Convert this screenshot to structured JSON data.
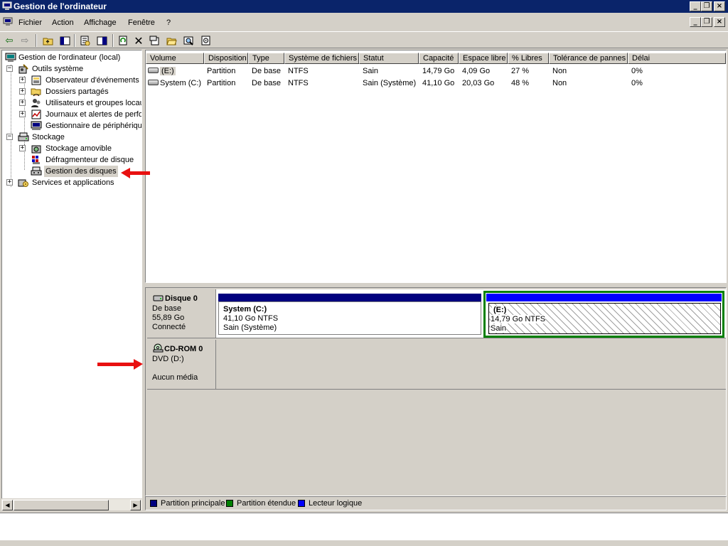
{
  "window": {
    "title": "Gestion de l'ordinateur"
  },
  "menu": {
    "items": [
      "Fichier",
      "Action",
      "Affichage",
      "Fenêtre",
      "?"
    ]
  },
  "toolbar": {
    "icons": [
      "back-arrow-icon",
      "forward-arrow-icon",
      "up-folder-icon",
      "show-hide-tree-icon",
      "properties-icon",
      "help-icon",
      "refresh-icon",
      "delete-icon",
      "properties-sheet-icon",
      "open-folder-icon",
      "search-icon",
      "settings-icon"
    ]
  },
  "tree": {
    "root": "Gestion de l'ordinateur (local)",
    "items": [
      {
        "label": "Outils système"
      },
      {
        "label": "Observateur d'événements"
      },
      {
        "label": "Dossiers partagés"
      },
      {
        "label": "Utilisateurs et groupes locaux"
      },
      {
        "label": "Journaux et alertes de performance"
      },
      {
        "label": "Gestionnaire de périphériques"
      },
      {
        "label": "Stockage"
      },
      {
        "label": "Stockage amovible"
      },
      {
        "label": "Défragmenteur de disque"
      },
      {
        "label": "Gestion des disques",
        "selected": true
      },
      {
        "label": "Services et applications"
      }
    ]
  },
  "volume_table": {
    "columns": [
      "Volume",
      "Disposition",
      "Type",
      "Système de fichiers",
      "Statut",
      "Capacité",
      "Espace libre",
      "% Libres",
      "Tolérance de pannes",
      "Délai"
    ],
    "rows": [
      {
        "volume": "(E:)",
        "disposition": "Partition",
        "type": "De base",
        "fs": "NTFS",
        "status": "Sain",
        "capacity": "14,79 Go",
        "free": "4,09 Go",
        "pct_free": "27 %",
        "fault_tolerance": "Non",
        "overhead": "0%"
      },
      {
        "volume": "System (C:)",
        "disposition": "Partition",
        "type": "De base",
        "fs": "NTFS",
        "status": "Sain (Système)",
        "capacity": "41,10 Go",
        "free": "20,03 Go",
        "pct_free": "48 %",
        "fault_tolerance": "Non",
        "overhead": "0%"
      }
    ]
  },
  "disks": [
    {
      "name": "Disque 0",
      "type": "De base",
      "size": "55,89 Go",
      "state": "Connecté",
      "partitions": [
        {
          "name": "System  (C:)",
          "size": "41,10 Go NTFS",
          "status": "Sain (Système)",
          "kind": "primary"
        },
        {
          "name": "(E:)",
          "size": "14,79 Go NTFS",
          "status": "Sain",
          "kind": "logical"
        }
      ]
    },
    {
      "name": "CD-ROM 0",
      "type": "DVD (D:)",
      "media": "Aucun média"
    }
  ],
  "legend": [
    {
      "label": "Partition principale",
      "color": "#00007f"
    },
    {
      "label": "Partition étendue",
      "color": "#008000"
    },
    {
      "label": "Lecteur logique",
      "color": "#0000ff"
    }
  ],
  "colors": {
    "titlebar": "#0a246a",
    "primary": "#00007f",
    "extended": "#008000",
    "logical": "#0000ff",
    "arrow": "#e81010"
  }
}
